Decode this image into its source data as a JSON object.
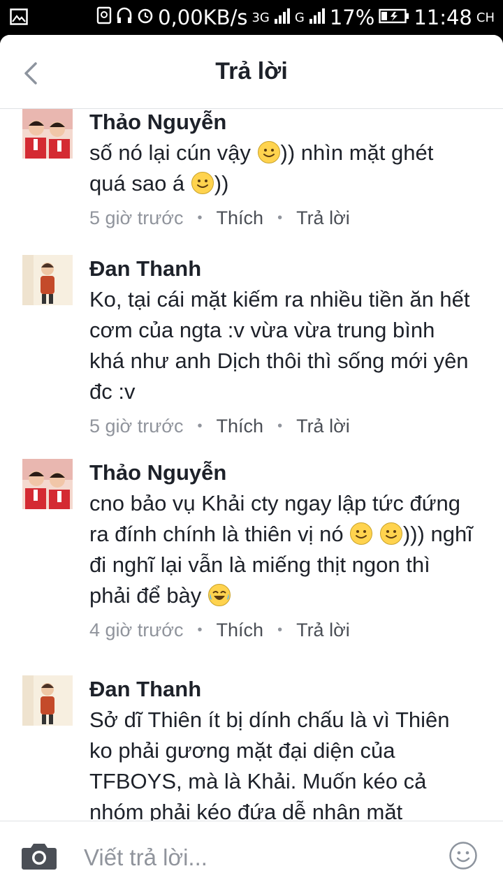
{
  "status_bar": {
    "network_speed": "0,00KB/s",
    "net1": "3G",
    "net2": "G",
    "battery": "17%",
    "time": "11:48",
    "ampm": "CH"
  },
  "header": {
    "title": "Trả lời"
  },
  "comments": [
    {
      "name": "Thảo Nguyễn",
      "lines": [
        "số nó lại cún vậy ",
        ")) nhìn mặt ghét",
        "quá sao á ",
        "))"
      ],
      "time": "5 giờ trước",
      "like": "Thích",
      "reply": "Trả lời"
    },
    {
      "name": "Đan Thanh",
      "text": "Ko, tại cái mặt kiếm ra nhiều tiền ăn hết cơm của ngta :v vừa vừa trung bình khá như anh Dịch thôi thì sống mới yên đc :v",
      "time": "5 giờ trước",
      "like": "Thích",
      "reply": "Trả lời"
    },
    {
      "name": "Thảo Nguyễn",
      "parts": [
        "cno bảo vụ Khải cty ngay lập tức đứng ra đính chính là thiên vị nó ",
        "))) nghĩ đi nghĩ lại vẫn là miếng thịt ngon thì phải để bày "
      ],
      "time": "4 giờ trước",
      "like": "Thích",
      "reply": "Trả lời"
    },
    {
      "name": "Đan Thanh",
      "text": "Sở dĩ Thiên ít bị dính chấu là vì Thiên ko phải gương mặt đại diện của TFBOYS, mà là Khải. Muốn kéo cả nhóm phải kéo đứa dễ nhận mặt"
    }
  ],
  "composer": {
    "placeholder": "Viết trả lời..."
  },
  "colors": {
    "text": "#1d2129",
    "meta": "#90949c",
    "link": "#4b4f56",
    "divider": "#dfe1e5"
  },
  "icons": [
    "image-icon",
    "back-chevron-icon",
    "camera-icon",
    "emoji-icon",
    "smiley-emoji",
    "laughing-emoji"
  ]
}
